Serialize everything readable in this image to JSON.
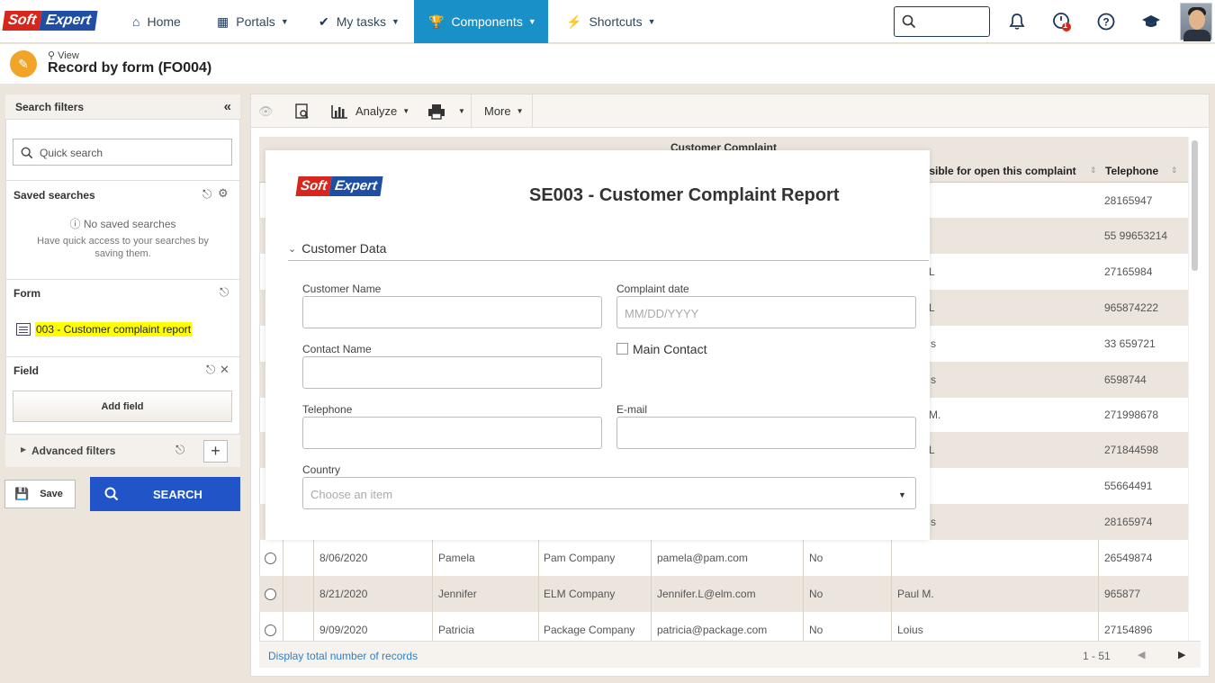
{
  "topnav": {
    "logo_left": "Soft",
    "logo_right": "Expert",
    "items": [
      {
        "label": "Home"
      },
      {
        "label": "Portals"
      },
      {
        "label": "My tasks"
      },
      {
        "label": "Components"
      },
      {
        "label": "Shortcuts"
      }
    ],
    "notification_count": "1",
    "accent_color": "#1a90c9"
  },
  "page": {
    "view_label": "View",
    "title": "Record by form (FO004)"
  },
  "filters": {
    "title": "Search filters",
    "quick_search_placeholder": "Quick search",
    "saved_searches_title": "Saved searches",
    "no_saved": "No saved searches",
    "no_saved_desc": "Have quick access to your searches by saving them.",
    "form_title": "Form",
    "form_item": "003 - Customer complaint report",
    "field_title": "Field",
    "add_field": "Add field",
    "advanced_filters": "Advanced filters",
    "save_label": "Save",
    "search_label": "SEARCH"
  },
  "toolbar": {
    "analyze": "Analyze",
    "more": "More"
  },
  "grid": {
    "group_header": "Customer Complaint",
    "columns": {
      "responsible": "nsible for open this complaint",
      "telephone": "Telephone"
    },
    "partial_rows": [
      {
        "responsible": "",
        "telephone": "28165947"
      },
      {
        "responsible": "",
        "telephone": "55 99653214"
      },
      {
        "responsible": "L",
        "telephone": "27165984"
      },
      {
        "responsible": "L",
        "telephone": "965874222"
      },
      {
        "responsible": "s",
        "telephone": "33 659721"
      },
      {
        "responsible": "s",
        "telephone": "6598744"
      },
      {
        "responsible": "M.",
        "telephone": "271998678"
      },
      {
        "responsible": "L",
        "telephone": "271844598"
      },
      {
        "responsible": "",
        "telephone": "55664491"
      },
      {
        "responsible": "s",
        "telephone": "28165974"
      }
    ],
    "rows": [
      {
        "date": "8/06/2020",
        "contact": "Pamela",
        "company": "Pam Company",
        "email": "pamela@pam.com",
        "main": "No",
        "responsible": "",
        "telephone": "26549874"
      },
      {
        "date": "8/21/2020",
        "contact": "Jennifer",
        "company": "ELM Company",
        "email": "Jennifer.L@elm.com",
        "main": "No",
        "responsible": "Paul M.",
        "telephone": "965877"
      },
      {
        "date": "9/09/2020",
        "contact": "Patricia",
        "company": "Package Company",
        "email": "patricia@package.com",
        "main": "No",
        "responsible": "Loius",
        "telephone": "27154896"
      }
    ],
    "footer_link": "Display total number of records",
    "range": "1 - 51"
  },
  "modal": {
    "logo_left": "Soft",
    "logo_right": "Expert",
    "title": "SE003 - Customer Complaint Report",
    "section": "Customer Data",
    "fields": {
      "customer_name": "Customer Name",
      "complaint_date": "Complaint date",
      "complaint_date_placeholder": "MM/DD/YYYY",
      "contact_name": "Contact Name",
      "main_contact": "Main Contact",
      "telephone": "Telephone",
      "email": "E-mail",
      "country": "Country",
      "country_placeholder": "Choose an item"
    }
  }
}
